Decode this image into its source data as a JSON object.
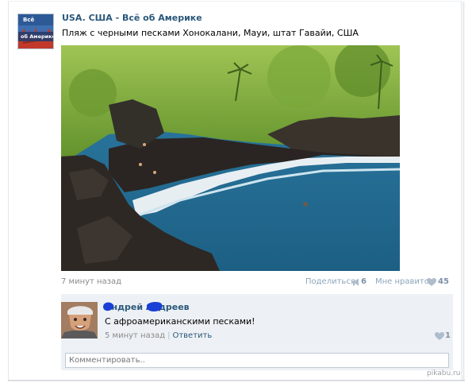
{
  "post": {
    "group_name": "USA. США - Всё об Америке",
    "text": "Пляж с черными песками Хонокалани, Мауи, штат Гавайи, США",
    "avatar_label_top": "Всё",
    "avatar_label_bottom": "об Америке",
    "time": "7 минут назад",
    "share_label": "Поделиться",
    "share_count": "6",
    "like_label": "Мне нравится",
    "like_count": "45",
    "photo_icon": "beach-photo"
  },
  "comment": {
    "author": "Андрей Андреев",
    "text": "С афроамериканскими песками!",
    "time": "5 минут назад",
    "separator": "|",
    "reply_label": "Ответить",
    "like_count": "1",
    "input_placeholder": "Комментировать.."
  },
  "watermark": "pikabu.ru",
  "colors": {
    "link": "#2b587a",
    "meta": "#8a8a8a",
    "comment_bg": "#edf1f5",
    "redaction": "#1a3fd6"
  },
  "icons": {
    "share": "megaphone-icon",
    "like": "heart-icon"
  }
}
